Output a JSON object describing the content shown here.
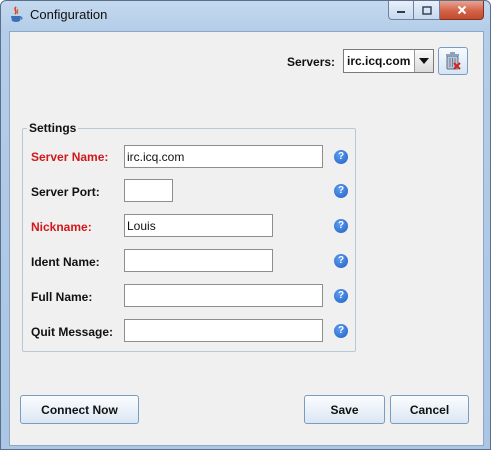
{
  "window": {
    "title": "Configuration"
  },
  "servers": {
    "label": "Servers:",
    "selected": "irc.icq.com"
  },
  "settings": {
    "title": "Settings",
    "fields": [
      {
        "label": "Server Name:",
        "value": "irc.icq.com",
        "required": true
      },
      {
        "label": "Server Port:",
        "value": "",
        "required": false
      },
      {
        "label": "Nickname:",
        "value": "Louis",
        "required": true
      },
      {
        "label": "Ident Name:",
        "value": "",
        "required": false
      },
      {
        "label": "Full Name:",
        "value": "",
        "required": false
      },
      {
        "label": "Quit Message:",
        "value": "",
        "required": false
      }
    ]
  },
  "buttons": {
    "connect": "Connect Now",
    "save": "Save",
    "cancel": "Cancel"
  },
  "icons": {
    "app": "java-cup-icon",
    "minimize": "minimize-icon",
    "maximize": "maximize-icon",
    "close": "close-icon",
    "dropdown": "chevron-down-icon",
    "delete_server": "trash-delete-icon",
    "help": "help-icon"
  },
  "colors": {
    "required_label": "#d0191c",
    "help_icon": "#1e5fc6"
  }
}
